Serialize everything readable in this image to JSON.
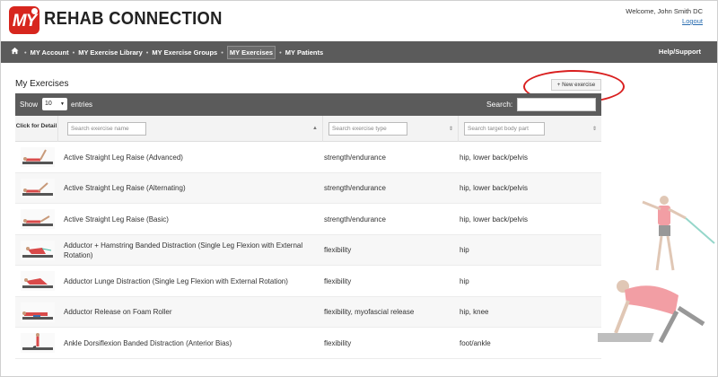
{
  "header": {
    "logo_text": "MY",
    "brand": "REHAB CONNECTION",
    "welcome": "Welcome, John Smith DC",
    "logout": "Logout"
  },
  "nav": {
    "items": [
      {
        "label": "MY Account",
        "active": false
      },
      {
        "label": "MY Exercise Library",
        "active": false
      },
      {
        "label": "MY Exercise Groups",
        "active": false
      },
      {
        "label": "MY Exercises",
        "active": true
      },
      {
        "label": "MY Patients",
        "active": false
      }
    ],
    "help": "Help/Support"
  },
  "page": {
    "title": "My Exercises",
    "new_button": "+ New exercise"
  },
  "toolbar": {
    "show": "Show",
    "entries_value": "10",
    "entries": "entries",
    "search": "Search:"
  },
  "table": {
    "detail_header": "Click for Detail",
    "placeholders": {
      "name": "Search exercise name",
      "type": "Search exercise type",
      "body": "Search target body part"
    },
    "rows": [
      {
        "name": "Active Straight Leg Raise (Advanced)",
        "type": "strength/endurance",
        "body": "hip, lower back/pelvis"
      },
      {
        "name": "Active Straight Leg Raise (Alternating)",
        "type": "strength/endurance",
        "body": "hip, lower back/pelvis"
      },
      {
        "name": "Active Straight Leg Raise (Basic)",
        "type": "strength/endurance",
        "body": "hip, lower back/pelvis"
      },
      {
        "name": "Adductor + Hamstring Banded Distraction (Single Leg Flexion with External Rotation)",
        "type": "flexibility",
        "body": "hip"
      },
      {
        "name": "Adductor Lunge Distraction (Single Leg Flexion with External Rotation)",
        "type": "flexibility",
        "body": "hip"
      },
      {
        "name": "Adductor Release on Foam Roller",
        "type": "flexibility, myofascial release",
        "body": "hip, knee"
      },
      {
        "name": "Ankle Dorsiflexion Banded Distraction (Anterior Bias)",
        "type": "flexibility",
        "body": "foot/ankle"
      }
    ]
  },
  "colors": {
    "brand_red": "#d7261e",
    "nav_bg": "#5b5b5b",
    "highlight_circle": "#d91f1f"
  }
}
